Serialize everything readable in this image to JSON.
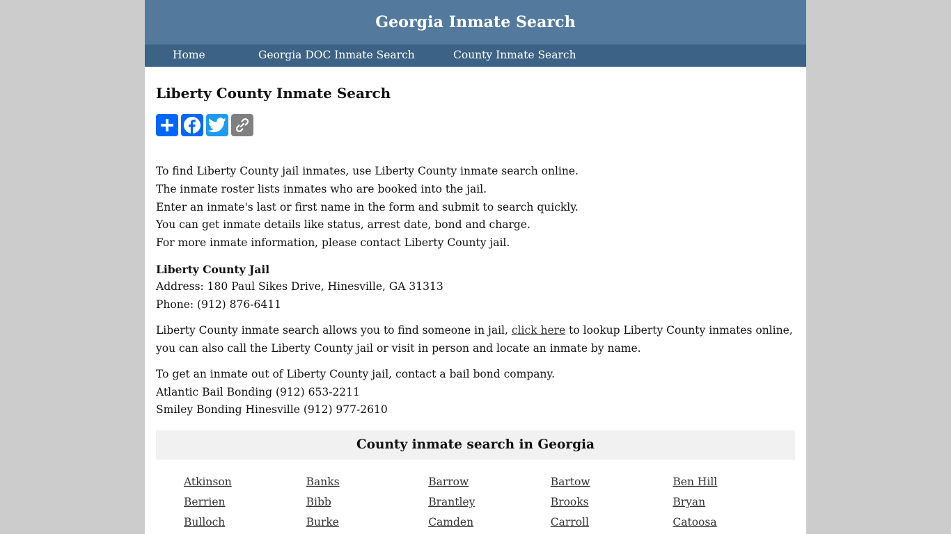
{
  "header": {
    "title": "Georgia Inmate Search"
  },
  "nav": {
    "items": [
      {
        "label": "Home"
      },
      {
        "label": "Georgia DOC Inmate Search"
      },
      {
        "label": "County Inmate Search"
      }
    ]
  },
  "main": {
    "heading": "Liberty County Inmate Search",
    "share": {
      "buttons": [
        {
          "icon": "share-plus-icon",
          "color": "#0166ff"
        },
        {
          "icon": "facebook-icon",
          "color": "#0866ff"
        },
        {
          "icon": "twitter-icon",
          "color": "#1d9bf0"
        },
        {
          "icon": "copy-link-icon",
          "color": "#808080"
        }
      ]
    },
    "intro_lines": [
      "To find Liberty County jail inmates, use Liberty County inmate search online.",
      "The inmate roster lists inmates who are booked into the jail.",
      "Enter an inmate's last or first name in the form and submit to search quickly.",
      "You can get inmate details like status, arrest date, bond and charge.",
      "For more inmate information, please contact Liberty County jail."
    ],
    "jail": {
      "name": "Liberty County Jail",
      "address": "Address: 180 Paul Sikes Drive, Hinesville, GA 31313",
      "phone": "Phone: (912) 876-6411"
    },
    "search_para": {
      "before": "Liberty County inmate search allows you to find someone in jail, ",
      "link": "click here",
      "after": " to lookup Liberty County inmates online, you can also call the Liberty County jail or visit in person and locate an inmate by name."
    },
    "bail": {
      "intro": "To get an inmate out of Liberty County jail, contact a bail bond company.",
      "companies": [
        "Atlantic Bail Bonding (912) 653-2211",
        "Smiley Bonding Hinesville (912) 977-2610"
      ]
    },
    "counties": {
      "title": "County inmate search in Georgia",
      "items": [
        "Atkinson",
        "Banks",
        "Barrow",
        "Bartow",
        "Ben Hill",
        "Berrien",
        "Bibb",
        "Brantley",
        "Brooks",
        "Bryan",
        "Bulloch",
        "Burke",
        "Camden",
        "Carroll",
        "Catoosa"
      ]
    }
  },
  "colors": {
    "header_bg": "#537a9d",
    "nav_bg": "#3c6285",
    "page_bg": "#cccccc",
    "county_box_bg": "#f1f1f1"
  }
}
